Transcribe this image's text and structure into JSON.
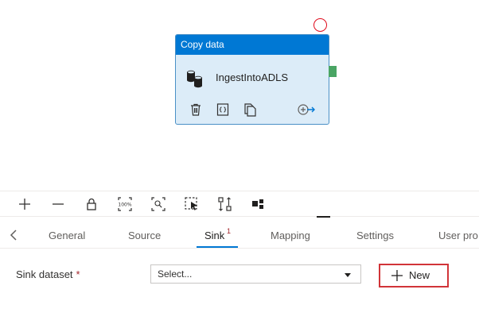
{
  "activity": {
    "type_label": "Copy data",
    "name": "IngestIntoADLS",
    "icons": [
      "database-icon",
      "delete-icon",
      "code-icon",
      "copy-icon",
      "add-output-icon"
    ]
  },
  "toolbar": {
    "icons": [
      "add-icon",
      "remove-icon",
      "lock-icon",
      "zoom-100-icon",
      "zoom-fit-icon",
      "select-icon",
      "auto-align-icon",
      "layout-icon"
    ]
  },
  "tabs": {
    "items": [
      {
        "label": "General"
      },
      {
        "label": "Source"
      },
      {
        "label": "Sink",
        "badge": "1",
        "active": true
      },
      {
        "label": "Mapping"
      },
      {
        "label": "Settings"
      },
      {
        "label": "User pro"
      }
    ]
  },
  "sink": {
    "label": "Sink dataset",
    "required_mark": "*",
    "select_value": "Select...",
    "new_button": "New"
  },
  "colors": {
    "accent": "#0078d4",
    "card_background": "#dcecf8",
    "error": "#e00b1c",
    "output_port": "#4aa564",
    "highlight_border": "#d13438"
  }
}
